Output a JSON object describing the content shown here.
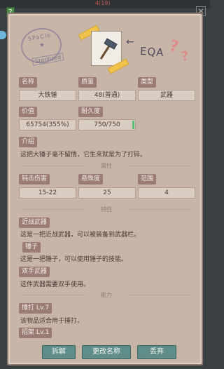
{
  "top_label": "4(19)",
  "help_glyph": "?",
  "close_glyph": "×",
  "stamp": {
    "top": "SPaCie",
    "star": "★",
    "bottom": "Sterilized"
  },
  "sticker": {
    "arrow": "←",
    "eqa": "EQA",
    "mark": "?"
  },
  "item": {
    "name_label": "名称",
    "name": "大铁锤",
    "quality_label": "质量",
    "quality": "48(普通)",
    "type_label": "类型",
    "type": "武器",
    "price_label": "价值",
    "price": "65754(355%)",
    "durability_label": "耐久度",
    "durability": "750/750",
    "intro_label": "介绍",
    "intro": "这把大锤子毫不留情，它生来就是为了打碎。"
  },
  "attributes": {
    "divider": "属性",
    "damage_label": "钝击伤害",
    "damage": "15-22",
    "heavy_label": "悬殊度",
    "heavy": "25",
    "range_label": "范围",
    "range": "4"
  },
  "traits": {
    "divider": "特性",
    "items": [
      {
        "label": "近战武器",
        "desc": "这是一把近战武器，可以被装备到武器栏。"
      },
      {
        "label": "锤子",
        "desc": "这是一把锤子，可以使用锤子的技能。"
      },
      {
        "label": "双手武器",
        "desc": "这件武器需要双手使用。"
      }
    ]
  },
  "abilities": {
    "divider": "能力",
    "items": [
      {
        "label": "捶打 Lv.7",
        "desc": "该物品适合用于捶打。"
      },
      {
        "label": "招架 Lv.1",
        "desc": ""
      }
    ]
  },
  "buttons": {
    "dismantle": "拆解",
    "rename": "更改名称",
    "discard": "丢弃"
  },
  "colors": {
    "panel": "#c7b6a8",
    "label": "#9a7c74",
    "button": "#5f8e8a",
    "tape": "#f2c34a",
    "question": "#e08b8b"
  },
  "icons": [
    "help-icon",
    "close-icon",
    "hammer-icon"
  ]
}
